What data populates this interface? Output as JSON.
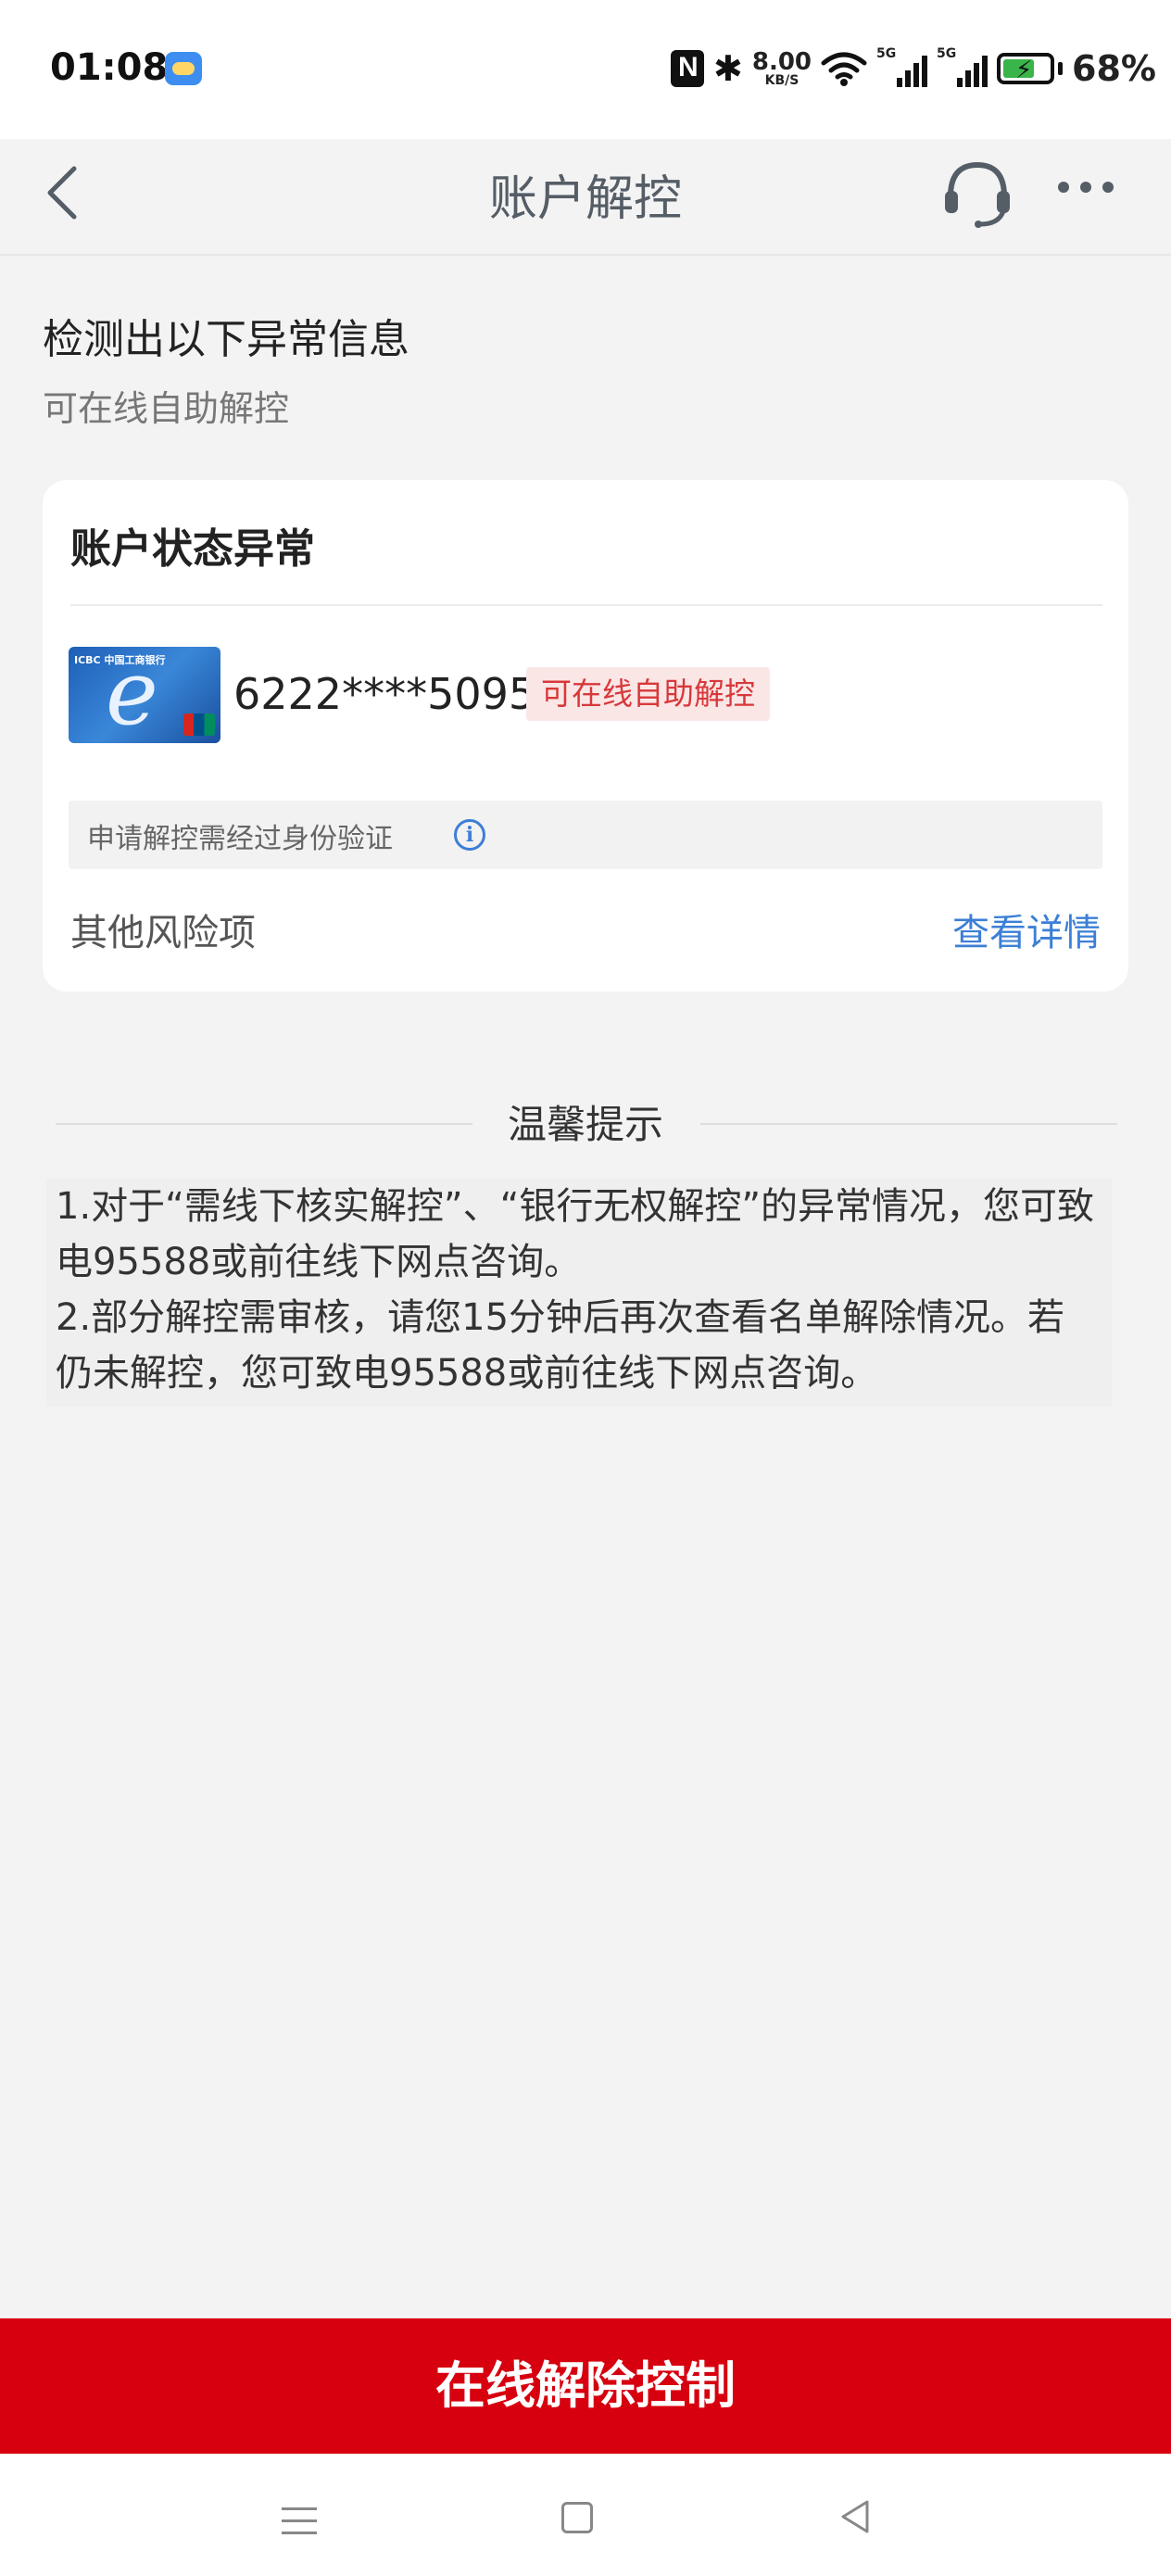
{
  "status_bar": {
    "time": "01:08",
    "net_speed_value": "8.00",
    "net_speed_unit": "KB/S",
    "signal1_label": "5G",
    "signal2_label": "5G",
    "battery_percent": "68%",
    "battery_level": 0.68,
    "icons": [
      "weather-icon",
      "nfc-icon",
      "bluetooth-icon",
      "wifi-icon",
      "signal-icon",
      "battery-icon"
    ]
  },
  "nav": {
    "title": "账户解控",
    "icons": [
      "back-icon",
      "customer-service-icon",
      "more-icon"
    ]
  },
  "header": {
    "title": "检测出以下异常信息",
    "subtitle": "可在线自助解控"
  },
  "card": {
    "title": "账户状态异常",
    "bank_card_brand": "ICBC 中国工商银行",
    "account_number": "6222****5095",
    "status_tag": "可在线自助解控",
    "notice": "申请解控需经过身份验证",
    "other_risk_label": "其他风险项",
    "view_detail_link": "查看详情"
  },
  "tips": {
    "title": "温馨提示",
    "lines": [
      "1.对于“需线下核实解控”、“银行无权解控”的异常情况，您可致",
      "电95588或前往线下网点咨询。",
      "2.部分解控需审核，请您15分钟后再次查看名单解除情况。若",
      "仍未解控，您可致电95588或前往线下网点咨询。"
    ]
  },
  "action": {
    "button_label": "在线解除控制"
  },
  "colors": {
    "primary_red": "#d6000f",
    "link_blue": "#3c7fd6",
    "tag_red": "#d8383b",
    "tag_bg": "#fbe6e6",
    "page_bg": "#f3f3f3"
  }
}
